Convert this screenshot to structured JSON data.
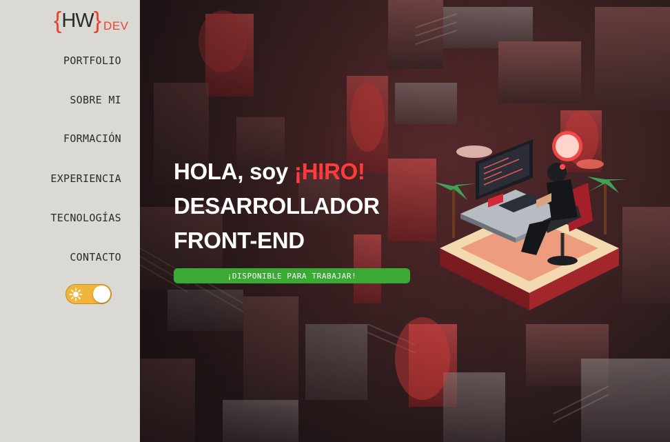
{
  "logo": {
    "open_brace": "{",
    "initials": "HW",
    "close_brace": "}",
    "suffix": "DEV"
  },
  "nav": {
    "items": [
      {
        "label": "PORTFOLIO"
      },
      {
        "label": "SOBRE MI"
      },
      {
        "label": "FORMACIÓN"
      },
      {
        "label": "EXPERIENCIA"
      },
      {
        "label": "TECNOLOGÍAS"
      },
      {
        "label": "CONTACTO"
      }
    ]
  },
  "theme_toggle": {
    "icon": "sun-icon",
    "state": "light"
  },
  "hero": {
    "greeting": "HOLA, soy",
    "name": "¡HIRO!",
    "role_line1": "DESARROLLADOR",
    "role_line2": "FRONT-END",
    "cta_label": "¡DISPONIBLE PARA TRABAJAR!"
  },
  "colors": {
    "accent": "#e8432f",
    "name_red": "#ff3b3b",
    "cta_green": "#3aaa35",
    "toggle_yellow": "#f0b53a",
    "sidebar_bg": "#dbd9d4"
  }
}
